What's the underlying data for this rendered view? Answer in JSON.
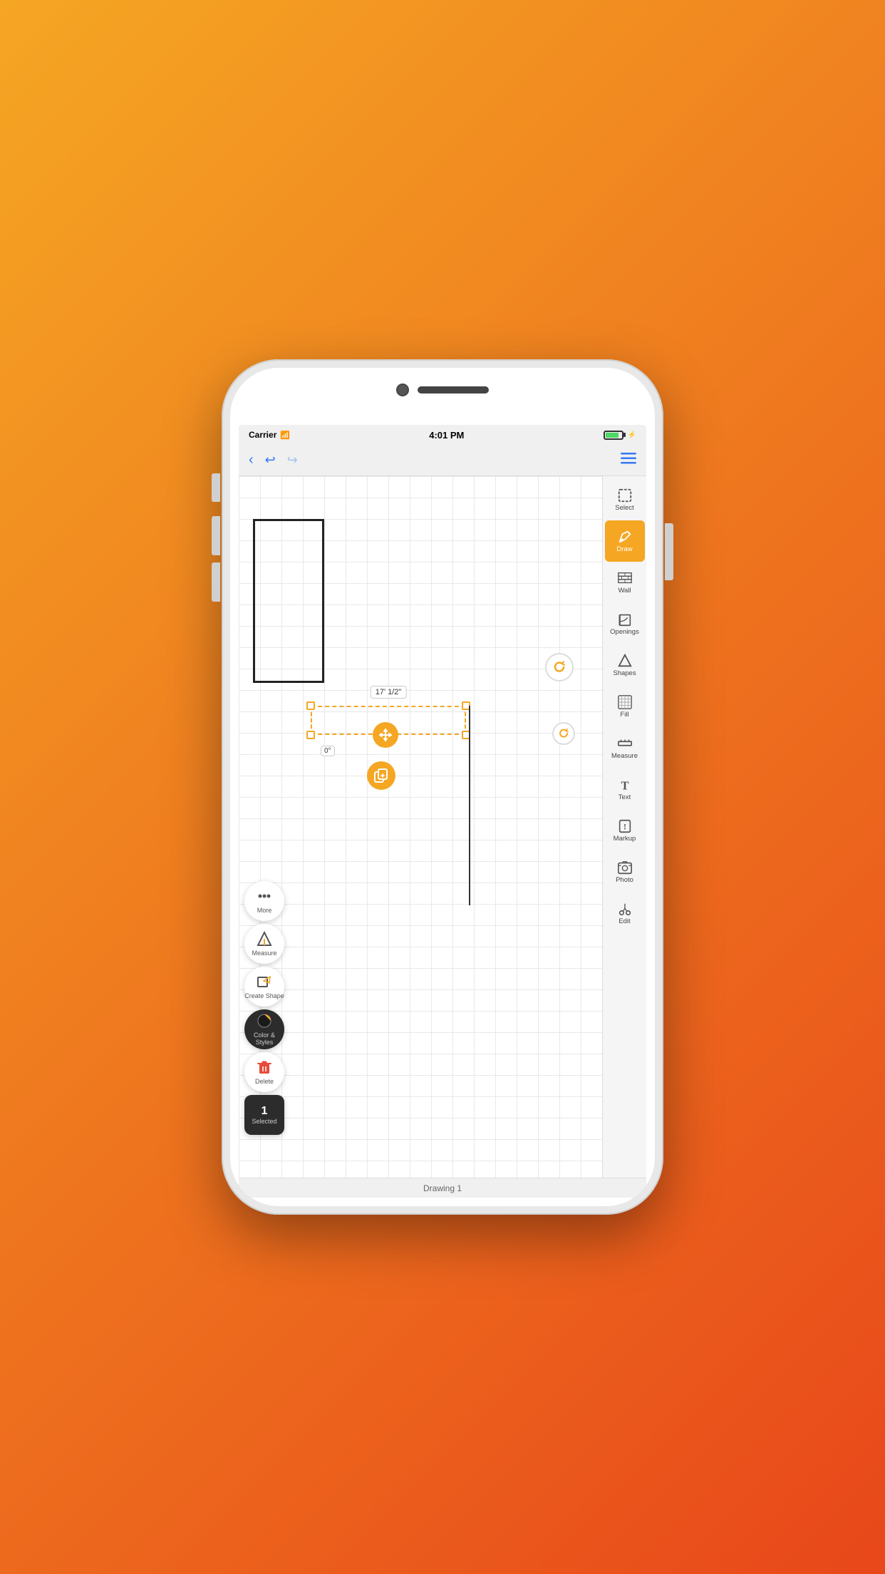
{
  "statusBar": {
    "carrier": "Carrier",
    "time": "4:01 PM"
  },
  "toolbar": {
    "backLabel": "‹",
    "undoLabel": "↩",
    "redoLabel": "↪",
    "menuLabel": "≡"
  },
  "canvas": {
    "dimensionLabel": "17' 1/2\"",
    "angleLabel": "0°"
  },
  "rightToolbar": {
    "items": [
      {
        "id": "select",
        "label": "Select",
        "icon": "select"
      },
      {
        "id": "draw",
        "label": "Draw",
        "icon": "draw",
        "active": true
      },
      {
        "id": "wall",
        "label": "Wall",
        "icon": "wall"
      },
      {
        "id": "openings",
        "label": "Openings",
        "icon": "openings"
      },
      {
        "id": "shapes",
        "label": "Shapes",
        "icon": "shapes"
      },
      {
        "id": "fill",
        "label": "Fill",
        "icon": "fill"
      },
      {
        "id": "measure",
        "label": "Measure",
        "icon": "measure"
      },
      {
        "id": "text",
        "label": "Text",
        "icon": "text"
      },
      {
        "id": "markup",
        "label": "Markup",
        "icon": "markup"
      },
      {
        "id": "photo",
        "label": "Photo",
        "icon": "photo"
      },
      {
        "id": "edit",
        "label": "Edit",
        "icon": "edit"
      }
    ]
  },
  "leftToolbar": {
    "items": [
      {
        "id": "more",
        "label": "More",
        "icon": "more"
      },
      {
        "id": "measure",
        "label": "Measure",
        "icon": "measure"
      },
      {
        "id": "create-shape",
        "label": "Create Shape",
        "icon": "create-shape"
      },
      {
        "id": "color-styles",
        "label": "Color & Styles",
        "icon": "color-styles"
      },
      {
        "id": "delete",
        "label": "Delete",
        "icon": "delete"
      }
    ],
    "selectedBadge": {
      "count": "1",
      "label": "Selected"
    }
  },
  "bottomBar": {
    "title": "Drawing 1"
  }
}
